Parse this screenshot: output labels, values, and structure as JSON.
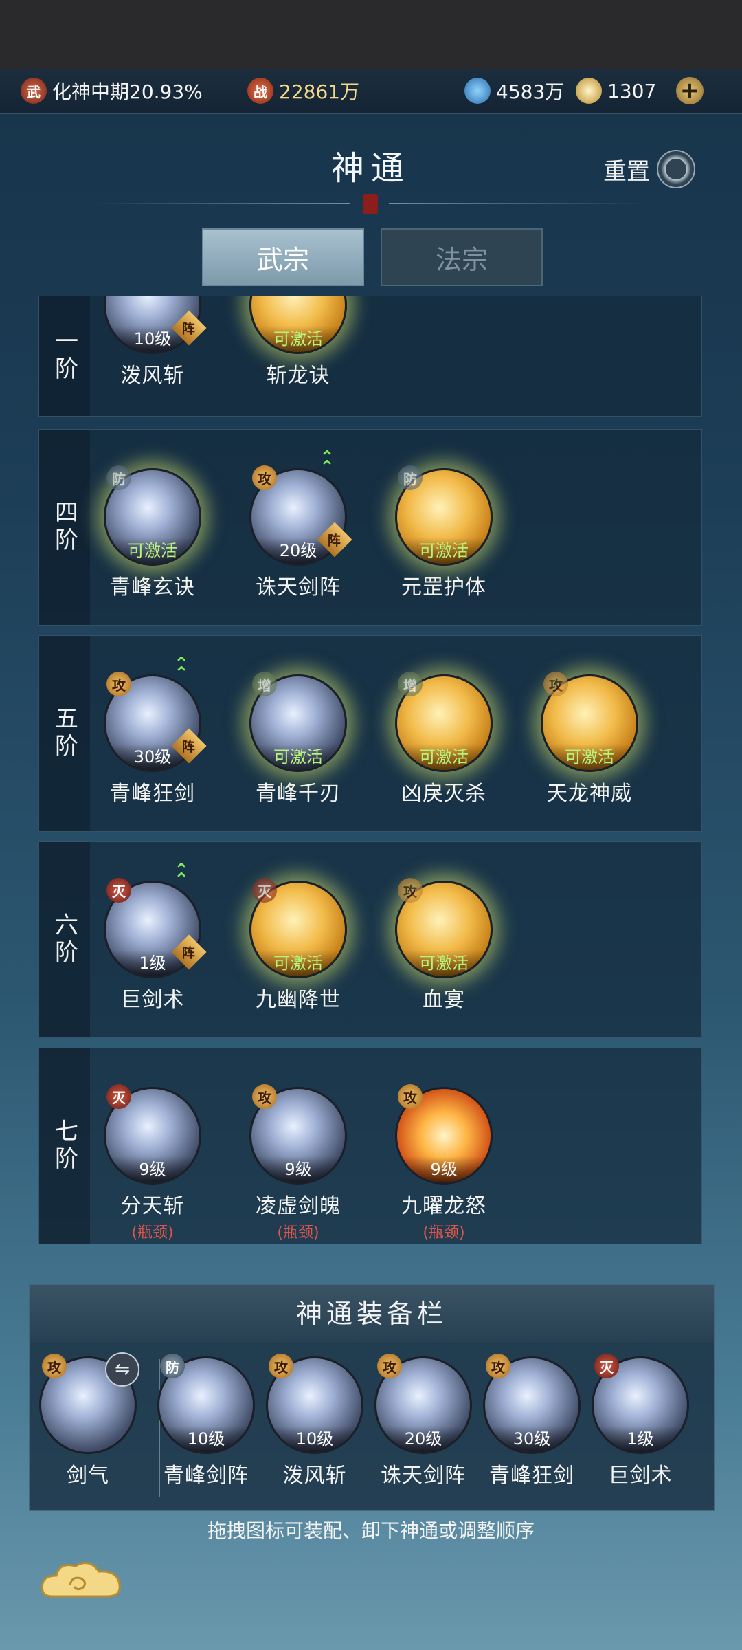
{
  "resources": {
    "realm_badge": "武",
    "realm_text": "化神中期20.93%",
    "power_badge": "战",
    "power_text": "22861万",
    "crystal_text": "4583万",
    "spirit_text": "1307",
    "plus": "+"
  },
  "header": {
    "title": "神通",
    "seal": "",
    "reset_label": "重置"
  },
  "tabs": [
    {
      "label": "武宗",
      "active": true
    },
    {
      "label": "法宗",
      "active": false
    }
  ],
  "tiers": [
    {
      "label": "一阶",
      "skills": [
        {
          "name": "泼风斩",
          "status": "10级",
          "style": "silver",
          "formation": "阵"
        },
        {
          "name": "斩龙诀",
          "status": "可激活",
          "style": "gold",
          "glow": true
        }
      ]
    },
    {
      "label": "四阶",
      "skills": [
        {
          "name": "青峰玄诀",
          "status": "可激活",
          "type": "防",
          "style": "silver",
          "glow": true
        },
        {
          "name": "诛天剑阵",
          "status": "20级",
          "type": "攻",
          "style": "silver",
          "formation": "阵",
          "upgrade": true
        },
        {
          "name": "元罡护体",
          "status": "可激活",
          "type": "防",
          "style": "gold",
          "glow": true
        }
      ]
    },
    {
      "label": "五阶",
      "skills": [
        {
          "name": "青峰狂剑",
          "status": "30级",
          "type": "攻",
          "style": "silver",
          "formation": "阵",
          "upgrade": true
        },
        {
          "name": "青峰千刃",
          "status": "可激活",
          "type": "增",
          "style": "silver",
          "glow": true
        },
        {
          "name": "凶戾灭杀",
          "status": "可激活",
          "type": "增",
          "style": "gold",
          "glow": true
        },
        {
          "name": "天龙神威",
          "status": "可激活",
          "type": "攻",
          "style": "gold",
          "glow": true
        }
      ]
    },
    {
      "label": "六阶",
      "skills": [
        {
          "name": "巨剑术",
          "status": "1级",
          "type": "灭",
          "style": "silver",
          "formation": "阵",
          "upgrade": true
        },
        {
          "name": "九幽降世",
          "status": "可激活",
          "type": "灭",
          "style": "gold",
          "glow": true
        },
        {
          "name": "血宴",
          "status": "可激活",
          "type": "攻",
          "style": "gold",
          "glow": true
        }
      ]
    },
    {
      "label": "七阶",
      "skills": [
        {
          "name": "分天斩",
          "status": "9级",
          "type": "灭",
          "style": "silver",
          "note": "(瓶颈)"
        },
        {
          "name": "凌虚剑魄",
          "status": "9级",
          "type": "攻",
          "style": "silver",
          "note": "(瓶颈)"
        },
        {
          "name": "九曜龙怒",
          "status": "9级",
          "type": "攻",
          "style": "fire",
          "note": "(瓶颈)"
        }
      ]
    }
  ],
  "equip": {
    "title": "神通装备栏",
    "swap_icon": "⇋",
    "slots": [
      {
        "name": "剑气",
        "type": "攻",
        "level": ""
      },
      {
        "name": "青峰剑阵",
        "type": "防",
        "level": "10级"
      },
      {
        "name": "泼风斩",
        "type": "攻",
        "level": "10级"
      },
      {
        "name": "诛天剑阵",
        "type": "攻",
        "level": "20级"
      },
      {
        "name": "青峰狂剑",
        "type": "攻",
        "level": "30级"
      },
      {
        "name": "巨剑术",
        "type": "灭",
        "level": "1级"
      }
    ],
    "hint": "拖拽图标可装配、卸下神通或调整顺序"
  },
  "icons": {
    "reset": "refresh-swirl-icon",
    "crystal": "spirit-crystal-icon",
    "spirit": "spirit-orb-icon",
    "cloud": "auspicious-cloud-icon"
  }
}
